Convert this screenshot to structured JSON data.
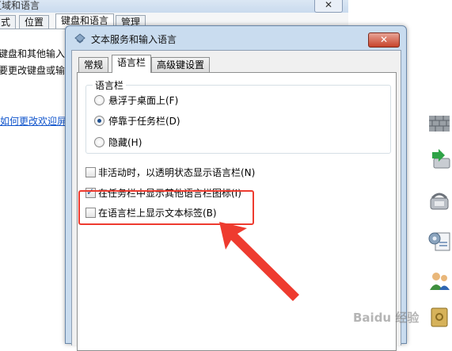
{
  "background_window": {
    "title": "区域和语言",
    "close_label": "✕",
    "tabs": [
      "式",
      "位置",
      "键盘和语言",
      "管理"
    ],
    "content_lines": [
      "键盘和其他输入",
      "要更改键盘或输"
    ],
    "link_text": "如何更改欢迎屏"
  },
  "dialog": {
    "title": "文本服务和输入语言",
    "close_label": "✕",
    "tabs": [
      "常规",
      "语言栏",
      "高级键设置"
    ],
    "active_tab": "语言栏",
    "group_label": "语言栏",
    "radios": [
      {
        "label": "悬浮于桌面上(F)",
        "checked": false
      },
      {
        "label": "停靠于任务栏(D)",
        "checked": true
      },
      {
        "label": "隐藏(H)",
        "checked": false
      }
    ],
    "checkboxes": [
      {
        "label": "非活动时，以透明状态显示语言栏(N)",
        "checked": false
      },
      {
        "label": "在任务栏中显示其他语言栏图标(I)",
        "checked": true
      },
      {
        "label": "在语言栏上显示文本标签(B)",
        "checked": false
      }
    ]
  },
  "annotation": {
    "color": "#ee3b2f"
  },
  "watermark": {
    "text": "Baidu 经验"
  }
}
